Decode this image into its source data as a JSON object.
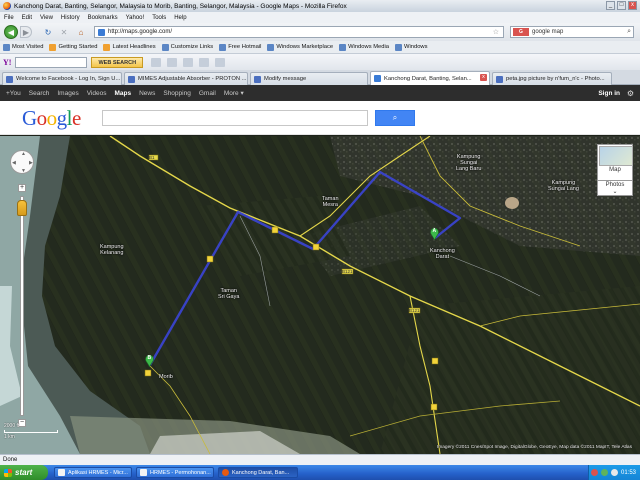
{
  "window": {
    "title": "Kanchong Darat, Banting, Selangor, Malaysia to Morib, Banting, Selangor, Malaysia - Google Maps - Mozilla Firefox",
    "controls": [
      "_",
      "□",
      "x"
    ]
  },
  "menu": [
    "File",
    "Edit",
    "View",
    "History",
    "Bookmarks",
    "Yahoo!",
    "Tools",
    "Help"
  ],
  "nav": {
    "url": "http://maps.google.com/",
    "search_value": "google map"
  },
  "bookmarks": [
    "Most Visited",
    "Getting Started",
    "Latest Headlines",
    "Customize Links",
    "Free Hotmail",
    "Windows Marketplace",
    "Windows Media",
    "Windows"
  ],
  "yahoo": {
    "logo": "Y!",
    "search_button": "WEB SEARCH"
  },
  "tabs": [
    {
      "label": "Welcome to Facebook - Log In, Sign U...",
      "active": false
    },
    {
      "label": "MIMES Adjustable Absorber - PROTON ...",
      "active": false
    },
    {
      "label": "Modify message",
      "active": false
    },
    {
      "label": "Kanchong Darat, Banting, Selan...",
      "active": true
    },
    {
      "label": "peta.jpg picture by n'fum_n'c - Photo...",
      "active": false
    }
  ],
  "google_bar": {
    "items": [
      "+You",
      "Search",
      "Images",
      "Videos",
      "Maps",
      "News",
      "Shopping",
      "Gmail",
      "More ▾"
    ],
    "active": "Maps",
    "signin": "Sign in"
  },
  "google_logo": "Google",
  "map": {
    "labels": {
      "kampung_kelanang": "Kampung\nKelanang",
      "taman_mesra": "Taman\nMesra",
      "kampung_sungai_lang_baru": "Kampung\nSungai\nLang Baru",
      "kampung_sungai_lang": "Kampung\nSungai Lang",
      "kanchong_darat": "Kanchong\nDarat",
      "taman_sri_gaya": "Taman\nSri Gaya",
      "morib": "Morib",
      "route_b1": "B1",
      "route_b121": "B121",
      "route_b18": "B18"
    },
    "map_type": "Map",
    "photos": "Photos",
    "scale_ft": "2000 ft",
    "scale_km": "1 km",
    "attribution": "Imagery ©2011 Cnes/Spot Image, DigitalGlobe, GeoEye, Map data ©2011 MapIT, Tele Atlas",
    "marker_a": "A",
    "marker_b": "B",
    "route_color": "#3b45d6"
  },
  "status": "Done",
  "taskbar": {
    "start": "start",
    "items": [
      {
        "label": "Aplikasi HRMES - Micr...",
        "active": false
      },
      {
        "label": "HRMES - Permohonan...",
        "active": false
      },
      {
        "label": "Kanchong Darat, Ban...",
        "active": true
      }
    ],
    "clock": "01:53"
  }
}
